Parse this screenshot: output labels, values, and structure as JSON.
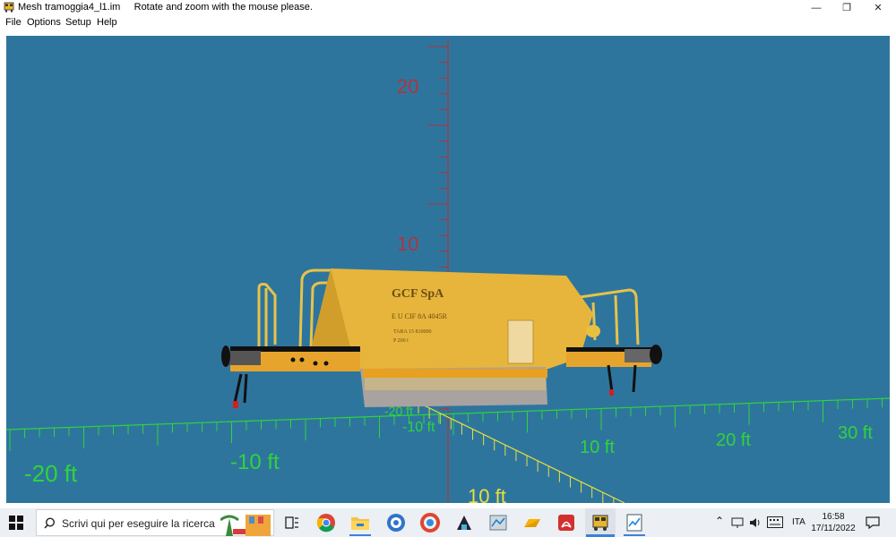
{
  "window": {
    "title": "Mesh tramoggia4_l1.im",
    "hint": "Rotate and zoom with the mouse please.",
    "minimize_glyph": "—",
    "restore_glyph": "❐",
    "close_glyph": "✕"
  },
  "menu": [
    {
      "label": "File"
    },
    {
      "label": "Options"
    },
    {
      "label": "Setup"
    },
    {
      "label": "Help"
    }
  ],
  "scene": {
    "vertical_axis_labels": [
      "20",
      "10"
    ],
    "floor_labels_x": [
      "-20 ft",
      "-10 ft",
      "10 ft",
      "20 ft",
      "30 ft"
    ],
    "floor_labels_center": [
      "-20 ft",
      "-10 ft"
    ],
    "depth_label": "10 ft",
    "wagon_marking": {
      "line1": "GCF SpA",
      "line2": "E U CIF 8A 4045R",
      "line3": "TARA 15 810000",
      "line4": "P 200 t"
    },
    "colors": {
      "background": "#2e759e",
      "axis_vertical": "#b0343c",
      "grid_floor": "#2fd43a",
      "grid_depth": "#e6e03a",
      "wagon_body": "#e7b53c"
    }
  },
  "taskbar": {
    "search_placeholder": "Scrivi qui per eseguire la ricerca",
    "language": "ITA",
    "time": "16:58",
    "date": "17/11/2022",
    "apps": [
      {
        "name": "task-view-icon"
      },
      {
        "name": "chrome-icon"
      },
      {
        "name": "file-explorer-icon"
      },
      {
        "name": "app-blue-icon"
      },
      {
        "name": "app-red-icon"
      },
      {
        "name": "app-dark-icon"
      },
      {
        "name": "app-map-icon"
      },
      {
        "name": "app-folder-yellow-icon"
      },
      {
        "name": "acrobat-icon"
      },
      {
        "name": "train-app-icon"
      },
      {
        "name": "app-chart-icon"
      }
    ]
  }
}
